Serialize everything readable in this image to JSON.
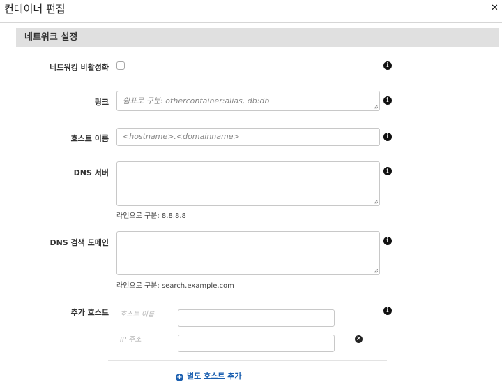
{
  "dialog": {
    "title": "컨테이너 편집",
    "close_icon": "close-icon"
  },
  "section": {
    "title": "네트워크 설정"
  },
  "fields": {
    "disable_networking": {
      "label": "네트워킹 비활성화",
      "checked": false
    },
    "links": {
      "label": "링크",
      "placeholder": "쉼표로 구분: othercontainer:alias, db:db"
    },
    "hostname": {
      "label": "호스트 이름",
      "placeholder": "<hostname>.<domainname>"
    },
    "dns_servers": {
      "label": "DNS 서버",
      "hint": "라인으로 구분: 8.8.8.8"
    },
    "dns_search": {
      "label": "DNS 검색 도메인",
      "hint": "라인으로 구분: search.example.com"
    },
    "extra_hosts": {
      "label": "추가 호스트",
      "hostname_label": "호스트 이름",
      "ip_label": "IP 주소",
      "add_label": "별도 호스트 추가"
    }
  },
  "icons": {
    "info": "i",
    "remove": "×",
    "plus": "+"
  },
  "colors": {
    "section_bg": "#e0e0e0",
    "link": "#1a5fb0"
  }
}
